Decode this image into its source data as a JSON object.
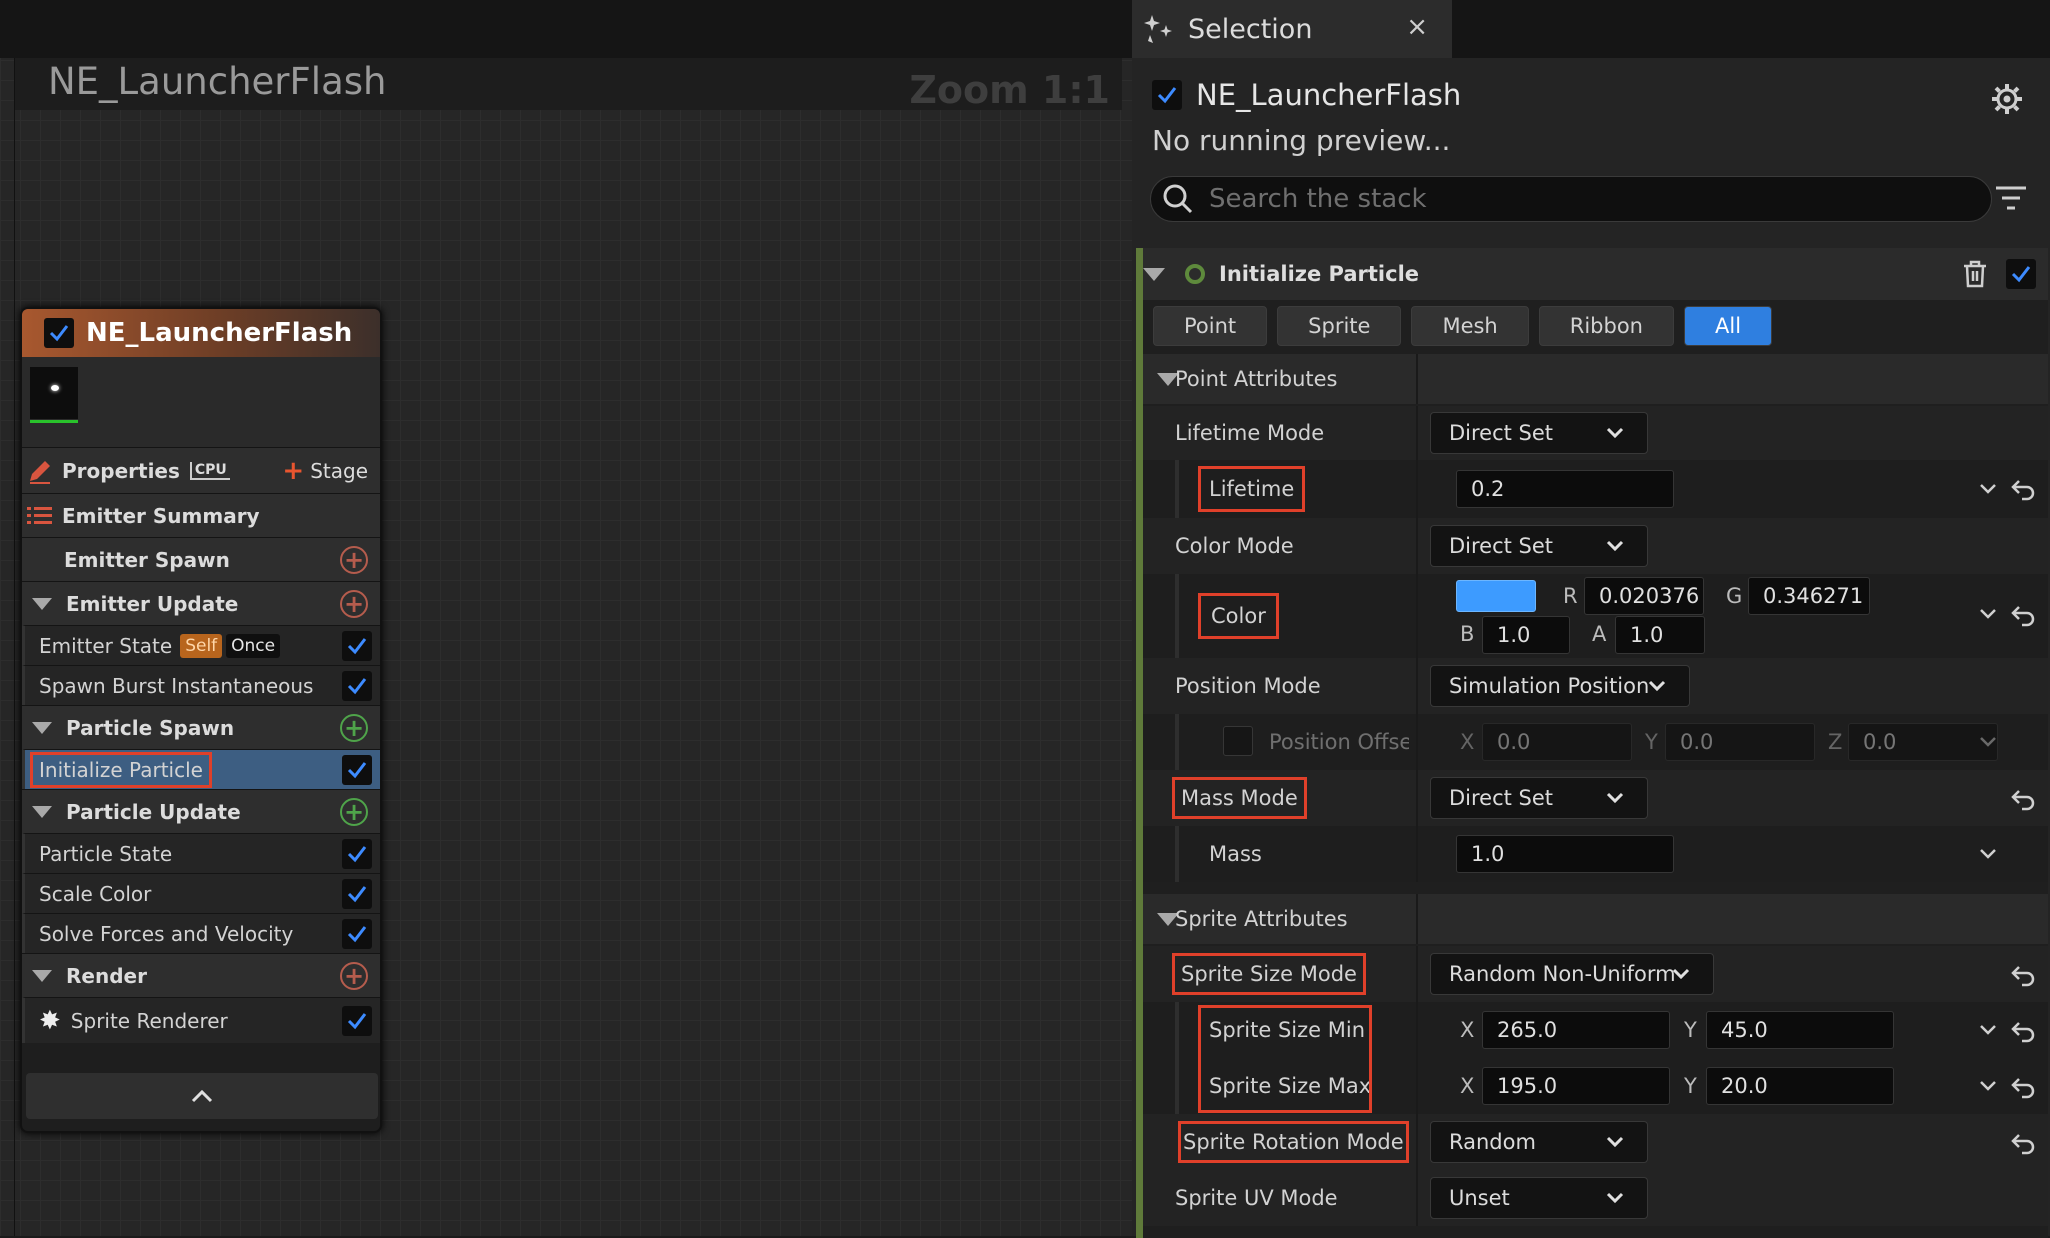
{
  "graph": {
    "title": "NE_LauncherFlash",
    "zoom": "Zoom 1:1"
  },
  "node": {
    "title": "NE_LauncherFlash",
    "properties_label": "Properties",
    "cpu_label": "CPU",
    "stage_label": "Stage",
    "emitter_summary": "Emitter Summary",
    "sections": {
      "emitter_spawn": "Emitter Spawn",
      "emitter_update": "Emitter Update",
      "particle_spawn": "Particle Spawn",
      "particle_update": "Particle Update",
      "render": "Render"
    },
    "items": {
      "emitter_state": "Emitter State",
      "self_tag": "Self",
      "once_tag": "Once",
      "spawn_burst": "Spawn Burst Instantaneous",
      "initialize_particle": "Initialize Particle",
      "particle_state": "Particle State",
      "scale_color": "Scale Color",
      "solve_forces": "Solve Forces and Velocity",
      "sprite_renderer": "Sprite Renderer"
    }
  },
  "panel": {
    "tab_title": "Selection",
    "tab_close": "×",
    "preview_title": "NE_LauncherFlash",
    "preview_status": "No running preview...",
    "search_placeholder": "Search the stack",
    "module_title": "Initialize Particle",
    "filters": [
      "Point",
      "Sprite",
      "Mesh",
      "Ribbon",
      "All"
    ],
    "active_filter": "All",
    "point_attributes": {
      "section": "Point Attributes",
      "lifetime_mode_label": "Lifetime Mode",
      "lifetime_mode_value": "Direct Set",
      "lifetime_label": "Lifetime",
      "lifetime_value": "0.2",
      "color_mode_label": "Color Mode",
      "color_mode_value": "Direct Set",
      "color_label": "Color",
      "color_swatch": "#3d9bff",
      "color_r_label": "R",
      "color_r": "0.020376",
      "color_g_label": "G",
      "color_g": "0.346271",
      "color_b_label": "B",
      "color_b": "1.0",
      "color_a_label": "A",
      "color_a": "1.0",
      "position_mode_label": "Position Mode",
      "position_mode_value": "Simulation Position",
      "position_offset_label": "Position Offset",
      "pos_x_label": "X",
      "pos_x": "0.0",
      "pos_y_label": "Y",
      "pos_y": "0.0",
      "pos_z_label": "Z",
      "pos_z": "0.0",
      "mass_mode_label": "Mass Mode",
      "mass_mode_value": "Direct Set",
      "mass_label": "Mass",
      "mass_value": "1.0"
    },
    "sprite_attributes": {
      "section": "Sprite Attributes",
      "size_mode_label": "Sprite Size Mode",
      "size_mode_value": "Random Non-Uniform",
      "size_min_label": "Sprite Size Min",
      "size_min_x_label": "X",
      "size_min_x": "265.0",
      "size_min_y_label": "Y",
      "size_min_y": "45.0",
      "size_max_label": "Sprite Size Max",
      "size_max_x_label": "X",
      "size_max_x": "195.0",
      "size_max_y_label": "Y",
      "size_max_y": "20.0",
      "rotation_mode_label": "Sprite Rotation Mode",
      "rotation_mode_value": "Random",
      "uv_mode_label": "Sprite UV Mode",
      "uv_mode_value": "Unset"
    }
  },
  "colors": {
    "accent": "#2f7fe0",
    "highlight_outline": "#e0402a",
    "module_bar": "#5f7a3a"
  }
}
